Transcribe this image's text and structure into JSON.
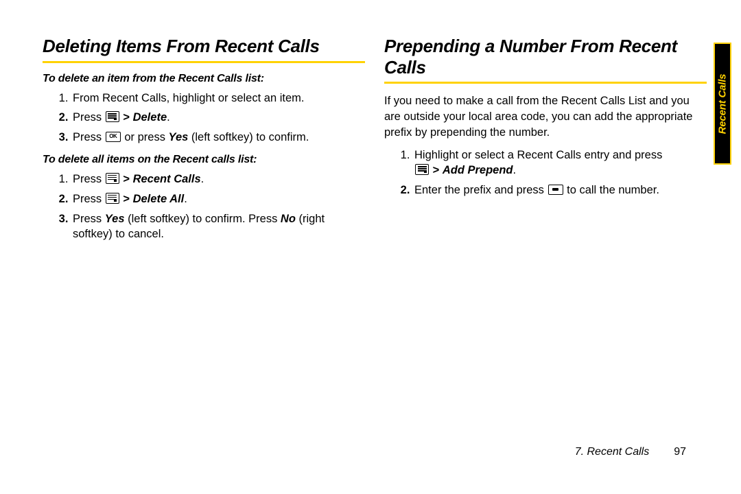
{
  "left": {
    "heading": "Deleting Items From Recent Calls",
    "lead1": "To delete an item from the Recent Calls list:",
    "s1_1": "From Recent Calls, highlight or select an item.",
    "s1_2a": "Press ",
    "s1_2b": " > ",
    "s1_2c": "Delete",
    "s1_2d": ".",
    "s1_3a": "Press ",
    "s1_3b": " or press ",
    "s1_3c": "Yes",
    "s1_3d": " (left softkey) to confirm.",
    "lead2": "To delete all items on the Recent calls list:",
    "s2_1a": "Press ",
    "s2_1b": " > ",
    "s2_1c": "Recent Calls",
    "s2_1d": ".",
    "s2_2a": "Press ",
    "s2_2b": " > ",
    "s2_2c": "Delete All",
    "s2_2d": ".",
    "s2_3a": "Press ",
    "s2_3b": "Yes ",
    "s2_3c": "(left softkey) to confirm. Press ",
    "s2_3d": "No",
    "s2_3e": " (right softkey) to cancel."
  },
  "right": {
    "heading": "Prepending a Number From Recent Calls",
    "intro": "If you need to make a call from the Recent Calls List and you are outside your local area code, you can add the appropriate prefix by prepending the number.",
    "s1a": "Highlight or select a Recent Calls entry and press ",
    "s1b": " > ",
    "s1c": "Add Prepend",
    "s1d": ".",
    "s2a": "Enter the prefix and press ",
    "s2b": " to call the number."
  },
  "sidetab": "Recent Calls",
  "footer_section": "7. Recent Calls",
  "footer_page": "97"
}
